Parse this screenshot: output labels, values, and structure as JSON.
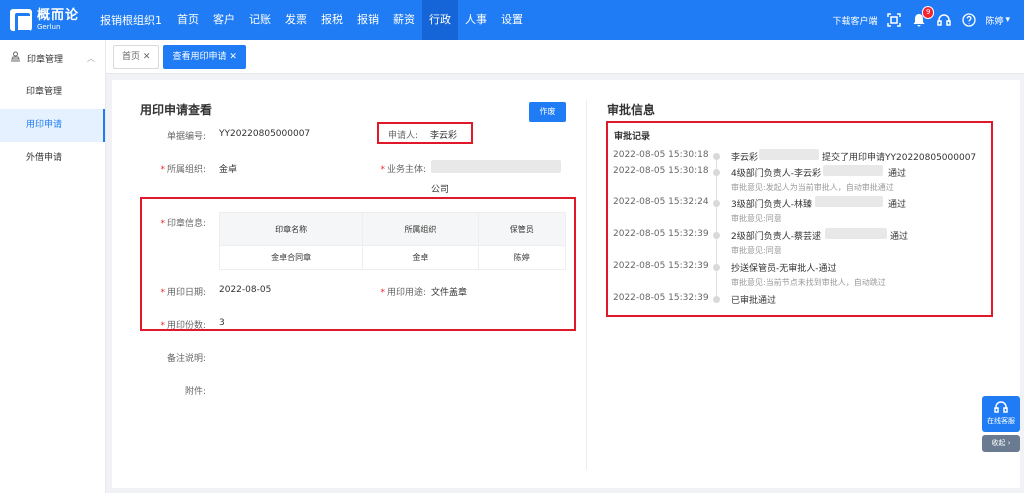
{
  "brand": {
    "cn": "概而论",
    "en": "Gerlun"
  },
  "org": "报销根组织1",
  "nav": [
    "首页",
    "客户",
    "记账",
    "发票",
    "报税",
    "报销",
    "薪资",
    "行政",
    "人事",
    "设置"
  ],
  "topright": {
    "download": "下载客户端",
    "badge": "9",
    "user": "陈婷"
  },
  "sidebar": {
    "group": "印章管理",
    "items": [
      "印章管理",
      "用印申请",
      "外借申请"
    ]
  },
  "tabs": [
    {
      "label": "首页"
    },
    {
      "label": "查看用印申请"
    }
  ],
  "form": {
    "title": "用印申请查看",
    "void_btn": "作废",
    "doc_no_label": "单据编号:",
    "doc_no": "YY20220805000007",
    "applicant_label": "申请人:",
    "applicant": "李云彩",
    "org_label": "所属组织:",
    "org": "金卓",
    "entity_label": "业务主体:",
    "entity_suffix": "公司",
    "seal_label": "印章信息:",
    "table_headers": [
      "印章名称",
      "所属组织",
      "保管员"
    ],
    "table_rows": [
      [
        "金卓合同章",
        "金卓",
        "陈婷"
      ]
    ],
    "date_label": "用印日期:",
    "date": "2022-08-05",
    "purpose_label": "用印用途:",
    "purpose": "文件盖章",
    "copies_label": "用印份数:",
    "copies": "3",
    "remark_label": "备注说明:",
    "attach_label": "附件:"
  },
  "approval": {
    "title": "审批信息",
    "record_title": "审批记录",
    "entries": [
      {
        "time": "2022-08-05 15:30:18",
        "text": "李云彩",
        "text2": "提交了用印申请YY20220805000007",
        "sub": ""
      },
      {
        "time": "2022-08-05 15:30:18",
        "text": "4级部门负责人-李云彩",
        "text2": "通过",
        "sub": "审批意见:发起人为当前审批人，自动审批通过"
      },
      {
        "time": "2022-08-05 15:32:24",
        "text": "3级部门负责人-林臻",
        "text2": "通过",
        "sub": "审批意见:同意"
      },
      {
        "time": "2022-08-05 15:32:39",
        "text": "2级部门负责人-蔡芸逑",
        "text2": "通过",
        "sub": "审批意见:同意"
      },
      {
        "time": "2022-08-05 15:32:39",
        "text": "抄送保管员-无审批人-通过",
        "text2": "",
        "sub": "审批意见:当前节点未找到审批人，自动跳过"
      },
      {
        "time": "2022-08-05 15:32:39",
        "text": "已审批通过",
        "text2": "",
        "sub": ""
      }
    ]
  },
  "float": {
    "service": "在线客服",
    "collapse": "收起"
  }
}
